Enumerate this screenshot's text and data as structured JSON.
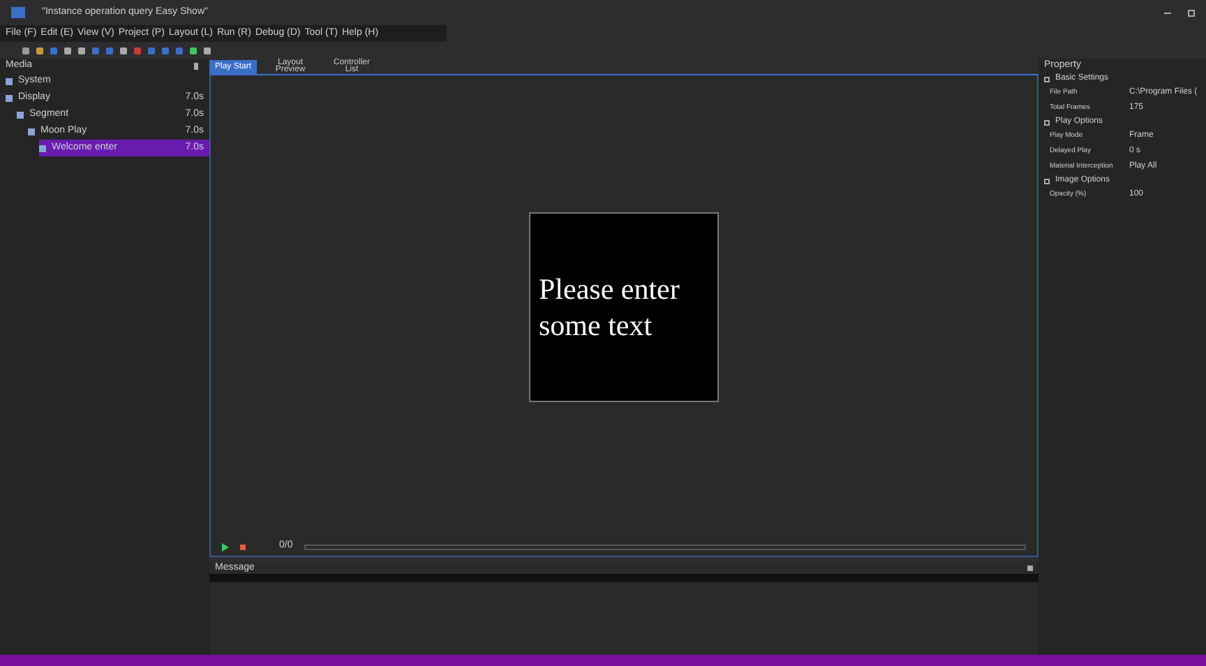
{
  "window": {
    "title": "\"Instance operation query Easy Show\""
  },
  "menu": [
    "File (F)",
    "Edit (E)",
    "View (V)",
    "Project (P)",
    "Layout (L)",
    "Run (R)",
    "Debug (D)",
    "Tool (T)",
    "Help (H)"
  ],
  "media": {
    "title": "Media",
    "items": [
      {
        "label": "System",
        "selected": false
      },
      {
        "label": "Display",
        "duration": "7.0s",
        "selected": false,
        "children": [
          {
            "label": "Segment",
            "duration": "7.0s",
            "selected": false,
            "children": [
              {
                "label": "Moon Play",
                "duration": "7.0s",
                "selected": false,
                "children": [
                  {
                    "label": "Welcome enter",
                    "duration": "7.0s",
                    "selected": true
                  }
                ]
              }
            ]
          }
        ]
      }
    ]
  },
  "tabs": [
    {
      "label": "Play Start",
      "selected": true
    },
    {
      "label": "Layout Preview",
      "selected": false
    },
    {
      "label": "Controller List",
      "selected": false
    }
  ],
  "canvas": {
    "text": "Please enter some text"
  },
  "playback": {
    "counter": "0/0"
  },
  "message": {
    "title": "Message"
  },
  "property": {
    "title": "Property",
    "groups": [
      {
        "title": "Basic Settings",
        "rows": [
          {
            "label": "File Path",
            "value": "C:\\Program Files ("
          },
          {
            "label": "Total Frames",
            "value": "175"
          }
        ]
      },
      {
        "title": "Play Options",
        "rows": [
          {
            "label": "Play Mode",
            "value": "Frame"
          },
          {
            "label": "Delayed Play",
            "value": "0 s"
          },
          {
            "label": "Material Interception",
            "value": "Play All"
          }
        ]
      },
      {
        "title": "Image Options",
        "rows": [
          {
            "label": "Opacity (%)",
            "value": "100"
          }
        ]
      }
    ]
  }
}
